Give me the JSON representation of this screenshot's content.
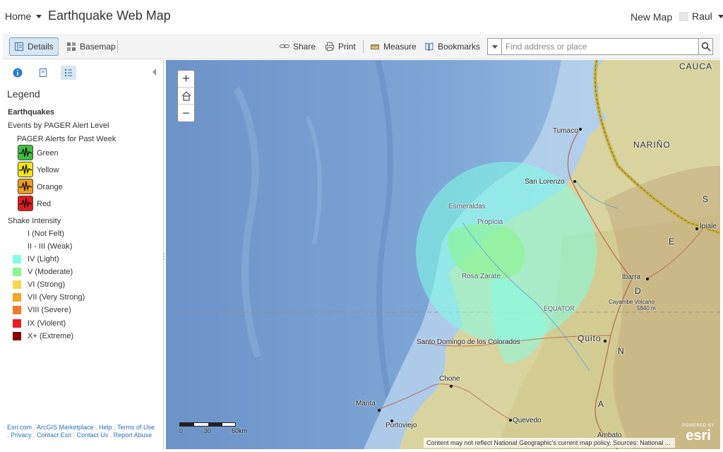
{
  "header": {
    "home_label": "Home",
    "title": "Earthquake Web Map",
    "new_map_label": "New Map",
    "user_name": "Raul"
  },
  "toolbar": {
    "details_label": "Details",
    "basemap_label": "Basemap",
    "share_label": "Share",
    "print_label": "Print",
    "measure_label": "Measure",
    "bookmarks_label": "Bookmarks",
    "search_placeholder": "Find address or place"
  },
  "sidebar": {
    "legend_title": "Legend",
    "layer_title": "Earthquakes",
    "subtitle": "Events by PAGER Alert Level",
    "pager_heading": "PAGER Alerts for Past Week",
    "pager_alerts": [
      {
        "label": "Green",
        "color": "#3fbf3f"
      },
      {
        "label": "Yellow",
        "color": "#f2e619"
      },
      {
        "label": "Orange",
        "color": "#f29a1a"
      },
      {
        "label": "Red",
        "color": "#e31a1c"
      }
    ],
    "shake_heading": "Shake Intensity",
    "shake_levels": [
      {
        "label": "I (Not Felt)",
        "color": ""
      },
      {
        "label": "II - III (Weak)",
        "color": ""
      },
      {
        "label": "IV (Light)",
        "color": "#7fffe6"
      },
      {
        "label": "V (Moderate)",
        "color": "#8cf58c"
      },
      {
        "label": "VI (Strong)",
        "color": "#f7d64a"
      },
      {
        "label": "VII (Very Strong)",
        "color": "#f5a623"
      },
      {
        "label": "VIII (Severe)",
        "color": "#f57a2a"
      },
      {
        "label": "IX (Violent)",
        "color": "#ec1c24"
      },
      {
        "label": "X+ (Extreme)",
        "color": "#8b0000"
      }
    ],
    "footer": {
      "esri_com": "Esri.com",
      "marketplace": "ArcGIS Marketplace",
      "help": "Help",
      "terms": "Terms of Use",
      "privacy": "Privacy",
      "contact_esri": "Contact Esri",
      "contact_us": "Contact Us",
      "report_abuse": "Report Abuse"
    }
  },
  "map": {
    "labels": {
      "cauca": "CAUCA",
      "narino": "NARIÑO",
      "tumaco": "Tumaco",
      "san_lorenzo": "San Lorenzo",
      "esmeraldas": "Esmeraldas",
      "propicia": "Propicia",
      "rosa_zarate": "Rosa Zarate",
      "ibarra": "Ibarra",
      "ipiales": "Ipiale",
      "cayambe": "Cayambe Volcano",
      "cayambe_elev": "5840 m",
      "equator": "EQUATOR",
      "quito": "Quito",
      "santo_domingo": "Santo Domingo de los Colorados",
      "chone": "Chone",
      "manta": "Manta",
      "portoviejo": "Portoviejo",
      "quevedo": "Quevedo",
      "ambato": "Ambato"
    },
    "scale": {
      "zero": "0",
      "mid": "30",
      "end": "60km"
    },
    "attribution": "Content may not reflect National Geographic's current map policy. Sources: National ...",
    "esri_powered": "POWERED BY",
    "esri_name": "esri"
  }
}
